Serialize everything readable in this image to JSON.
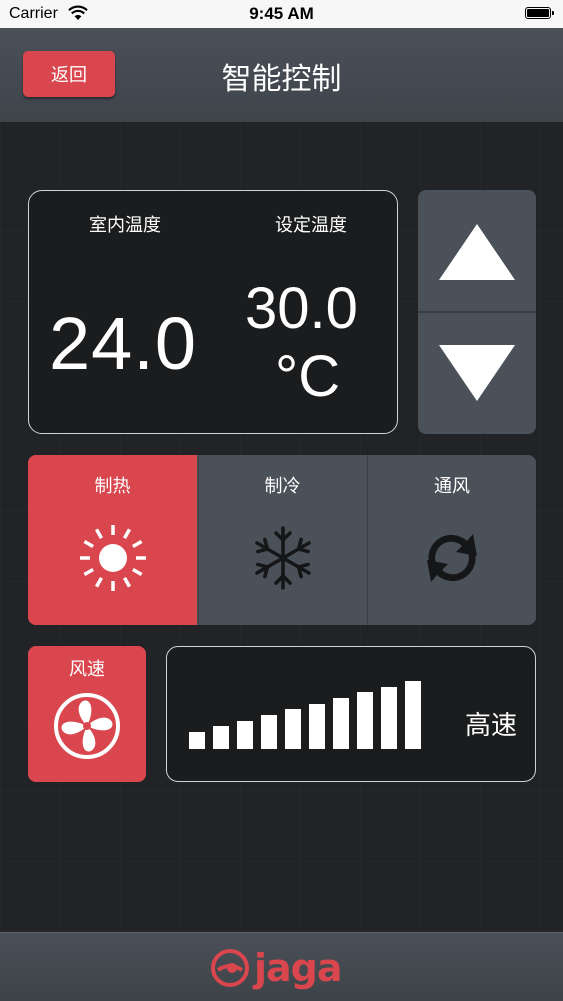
{
  "status_bar": {
    "carrier": "Carrier",
    "time": "9:45 AM"
  },
  "header": {
    "back_label": "返回",
    "title": "智能控制"
  },
  "temperature": {
    "indoor_label": "室内温度",
    "setpoint_label": "设定温度",
    "indoor_value": "24.0",
    "setpoint_value": "30.0",
    "unit": "°C"
  },
  "adjust": {
    "up_icon": "triangle-up-icon",
    "down_icon": "triangle-down-icon"
  },
  "modes": [
    {
      "label": "制热",
      "icon": "sun-icon",
      "active": true
    },
    {
      "label": "制冷",
      "icon": "snowflake-icon",
      "active": false
    },
    {
      "label": "通风",
      "icon": "sync-icon",
      "active": false
    }
  ],
  "fan": {
    "label": "风速",
    "icon": "fan-icon",
    "level": 10,
    "max_level": 10,
    "speed_text": "高速"
  },
  "footer": {
    "logo_text": "jaga"
  },
  "colors": {
    "accent": "#d9464d",
    "panel": "#4b5158",
    "card": "#1b1c1e",
    "header": "#474c53"
  }
}
